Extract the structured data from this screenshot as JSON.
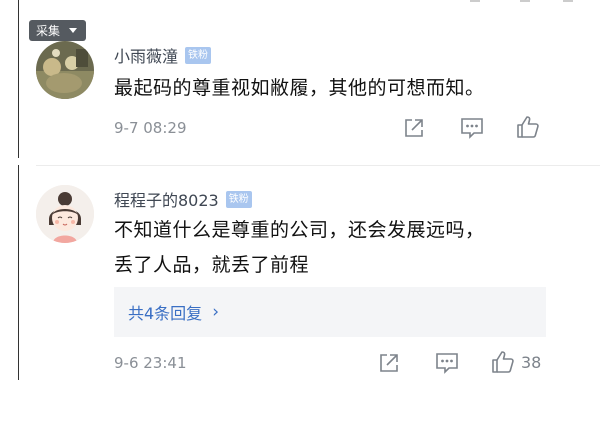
{
  "collect_tag": {
    "label": "采集"
  },
  "comments": [
    {
      "name": "小雨薇潼",
      "badge": "铁粉",
      "text_lines": [
        "最起码的尊重视如敝履，其他的可想而知。"
      ],
      "time": "9-7 08:29",
      "like_count": ""
    },
    {
      "name": "程程子的8023",
      "badge": "铁粉",
      "text_lines": [
        "不知道什么是尊重的公司，还会发展远吗，",
        "丢了人品，就丢了前程"
      ],
      "reply_link": "共4条回复",
      "reply_chevron": "›",
      "time": "9-6 23:41",
      "like_count": "38"
    }
  ],
  "icons": {
    "share": "share-icon",
    "reply": "comment-icon",
    "like": "thumbs-up-icon"
  },
  "colors": {
    "badge": "#a9c6ef",
    "link": "#3a6fc4",
    "meta": "#8a8f96"
  }
}
